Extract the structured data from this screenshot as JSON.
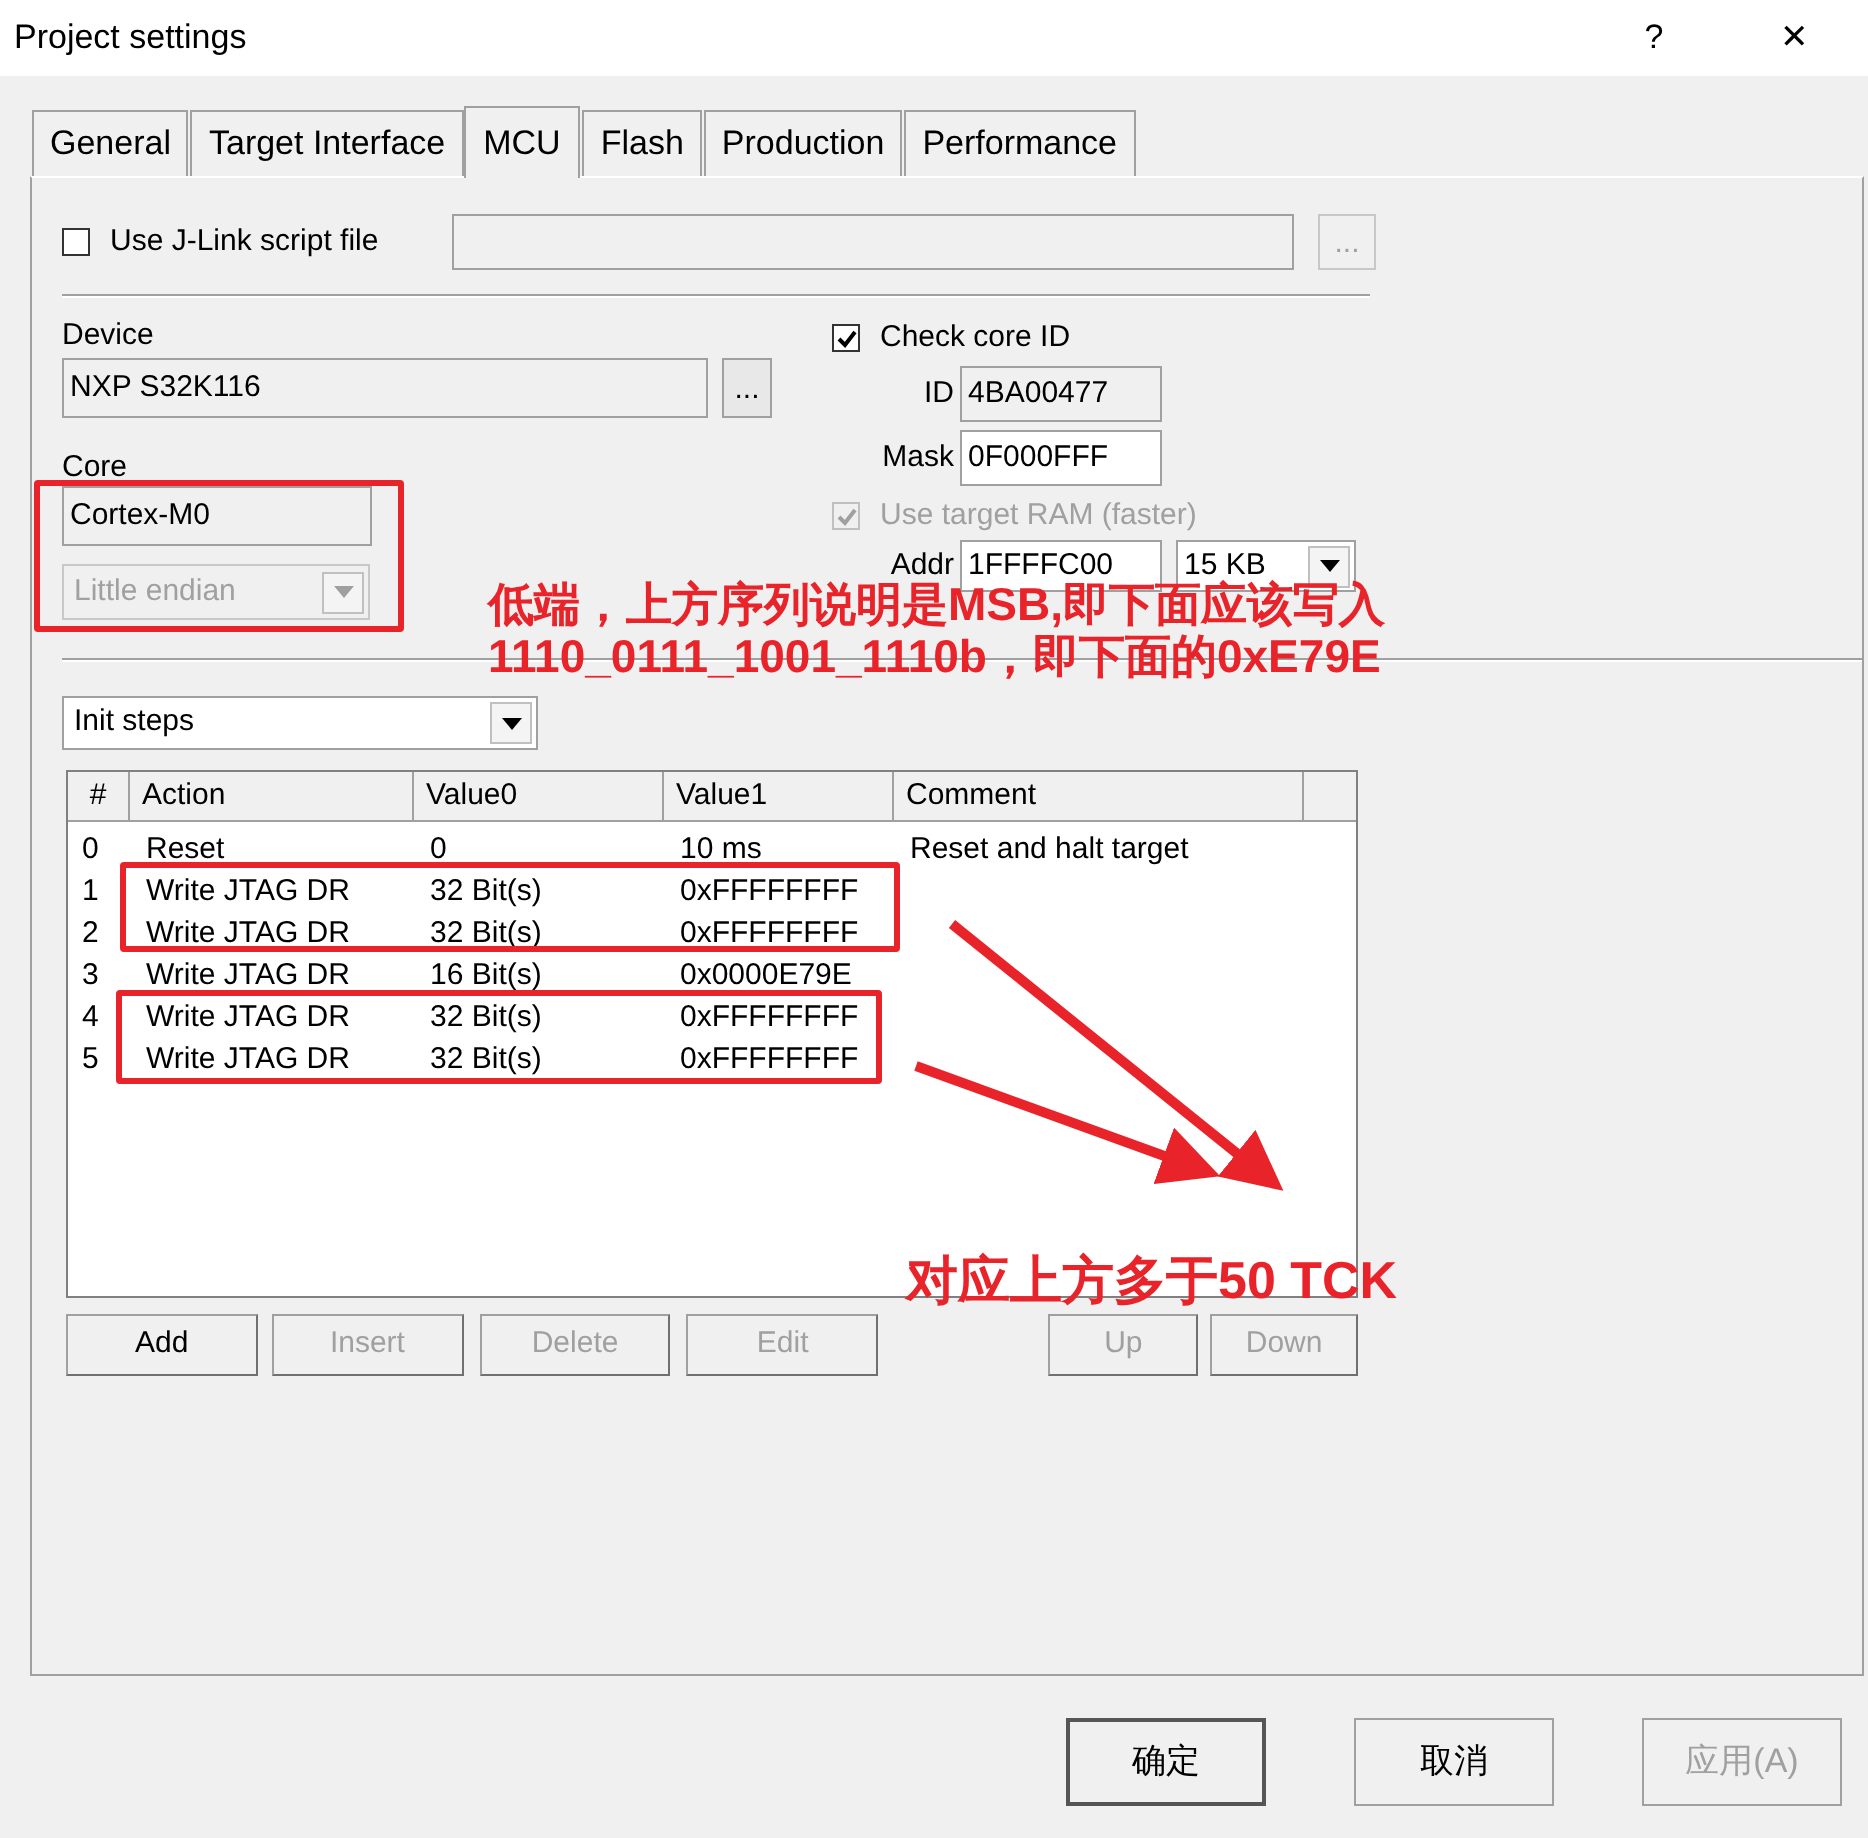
{
  "window": {
    "title": "Project settings",
    "help_button": "?",
    "close_button": "✕"
  },
  "tabs": [
    {
      "label": "General",
      "selected": false
    },
    {
      "label": "Target Interface",
      "selected": false
    },
    {
      "label": "MCU",
      "selected": true
    },
    {
      "label": "Flash",
      "selected": false
    },
    {
      "label": "Production",
      "selected": false
    },
    {
      "label": "Performance",
      "selected": false
    }
  ],
  "script_file": {
    "label": "Use J-Link script file",
    "checked": false,
    "browse": "..."
  },
  "device": {
    "label": "Device",
    "value": "NXP S32K116",
    "browse": "..."
  },
  "core": {
    "label": "Core",
    "value": "Cortex-M0",
    "endianness": {
      "value": "Little endian",
      "disabled": true
    }
  },
  "core_id": {
    "label": "Check core ID",
    "checked": true,
    "id_label": "ID",
    "id_value": "4BA00477",
    "mask_label": "Mask",
    "mask_value": "0F000FFF"
  },
  "target_ram": {
    "label": "Use target RAM (faster)",
    "checked": true,
    "disabled": true,
    "addr_label": "Addr",
    "addr_value": "1FFFFC00",
    "size": "15 KB"
  },
  "steps": {
    "selector": "Init steps",
    "columns": [
      "#",
      "Action",
      "Value0",
      "Value1",
      "Comment"
    ],
    "rows": [
      [
        "0",
        "Reset",
        "0",
        "10 ms",
        "Reset and halt target"
      ],
      [
        "1",
        "Write JTAG DR",
        "32 Bit(s)",
        "0xFFFFFFFF",
        ""
      ],
      [
        "2",
        "Write JTAG DR",
        "32 Bit(s)",
        "0xFFFFFFFF",
        ""
      ],
      [
        "3",
        "Write JTAG DR",
        "16 Bit(s)",
        "0x0000E79E",
        ""
      ],
      [
        "4",
        "Write JTAG DR",
        "32 Bit(s)",
        "0xFFFFFFFF",
        ""
      ],
      [
        "5",
        "Write JTAG DR",
        "32 Bit(s)",
        "0xFFFFFFFF",
        ""
      ]
    ],
    "buttons": [
      {
        "label": "Add",
        "disabled": false
      },
      {
        "label": "Insert",
        "disabled": true
      },
      {
        "label": "Delete",
        "disabled": true
      },
      {
        "label": "Edit",
        "disabled": true
      },
      {
        "label": "Up",
        "disabled": true
      },
      {
        "label": "Down",
        "disabled": true
      }
    ]
  },
  "dialog_buttons": [
    {
      "label": "确定",
      "disabled": false,
      "default": true
    },
    {
      "label": "取消",
      "disabled": false,
      "default": false
    },
    {
      "label": "应用(A)",
      "disabled": true,
      "default": false
    }
  ],
  "annotations": {
    "note": [
      "低端，上方序列说明是MSB,即下面应该写入",
      "1110_0111_1001_1110b，即下面的0xE79E"
    ],
    "note_2": "对应上方多于50 TCK"
  }
}
